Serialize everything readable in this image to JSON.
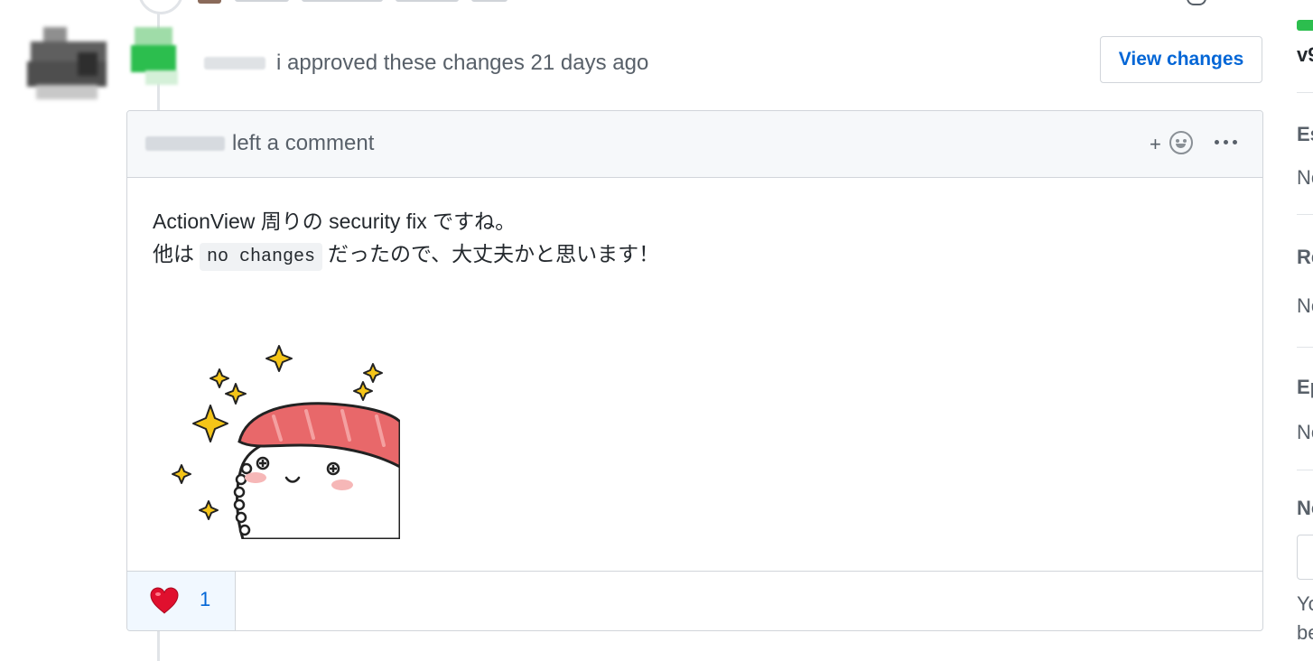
{
  "review": {
    "action_text": "i approved these changes 21 days ago",
    "view_changes_label": "View changes"
  },
  "comment": {
    "header_text": "left a comment",
    "add_reaction_plus": "+",
    "body_line1": "ActionView 周りの security fix ですね。",
    "body_line2_before": "他は",
    "body_code": "no changes",
    "body_line2_after": "だったので、大丈夫かと思います！",
    "sticker_icon": "sushi-sticker-icon"
  },
  "reactions": [
    {
      "icon": "heart-icon",
      "count": "1"
    }
  ],
  "sidebar": {
    "version_partial": "v9",
    "sections": [
      {
        "heading": "Es",
        "value": "No"
      },
      {
        "heading": "Re",
        "value": "No"
      },
      {
        "heading": "Ep",
        "value": "No"
      },
      {
        "heading": "No"
      }
    ],
    "note_line1": "Yo",
    "note_line2": "be"
  },
  "colors": {
    "link": "#0366d6",
    "border": "#d1d5da",
    "header_bg": "#f6f8fa",
    "reaction_bg": "#f1f8ff",
    "progress": "#2cbe4e"
  }
}
